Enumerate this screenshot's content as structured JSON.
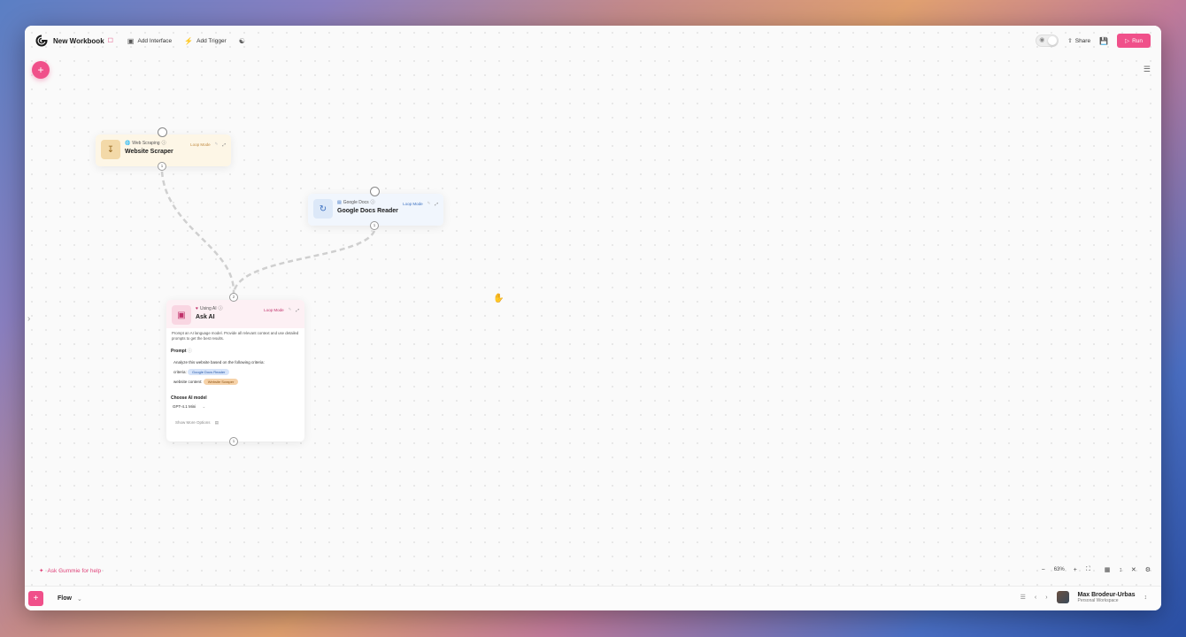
{
  "window": {
    "title": "New Workbook"
  },
  "toolbar": {
    "add_interface": "Add Interface",
    "add_trigger": "Add Trigger",
    "share": "Share",
    "run": "Run"
  },
  "nodes": {
    "web_scraper": {
      "type": "Web Scraping",
      "name": "Website Scraper",
      "loop": "Loop Mode",
      "out_port": "1"
    },
    "docs_reader": {
      "type": "Google Docs",
      "name": "Google Docs Reader",
      "loop": "Loop Mode",
      "out_port": "1"
    },
    "ask_ai": {
      "type": "Using AI",
      "name": "Ask AI",
      "loop": "Loop Mode",
      "in_port": "2",
      "out_port": "1",
      "description": "Prompt an AI language model. Provide all relevant context and use detailed prompts to get the best results.",
      "prompt_label": "Prompt",
      "prompt_line1": "Analyze this website based on the following criteria:",
      "criteria_label": "criteria:",
      "criteria_chip": "Google Docs Reader",
      "content_label": "website content:",
      "content_chip": "Website Scraper",
      "model_label": "Choose AI model",
      "model_value": "GPT-4.1 Mini",
      "more_options": "Show More Options"
    }
  },
  "help": {
    "label": "Ask Gummie for help"
  },
  "zoom": {
    "value": "63%"
  },
  "bottom": {
    "tab": "Flow",
    "user_name": "Max Brodeur-Urbas",
    "workspace": "Personal Workspace"
  },
  "colors": {
    "accent": "#f0508a"
  }
}
